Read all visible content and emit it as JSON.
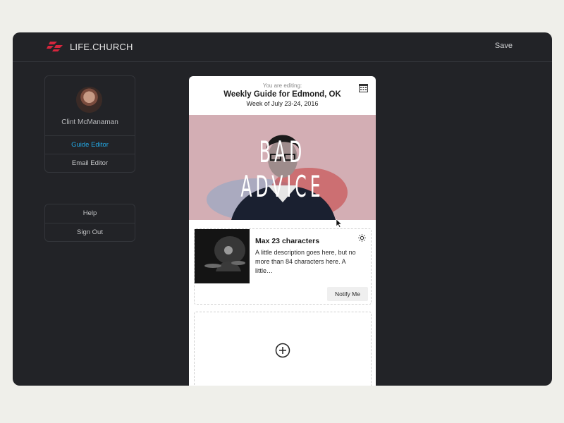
{
  "brand": {
    "name": "LIFE.CHURCH",
    "accent": "#d7263d"
  },
  "topbar": {
    "save_label": "Save"
  },
  "sidebar": {
    "user_name": "Clint McManaman",
    "items": [
      {
        "label": "Guide Editor",
        "active": true
      },
      {
        "label": "Email Editor",
        "active": false
      }
    ],
    "aux_items": [
      {
        "label": "Help"
      },
      {
        "label": "Sign Out"
      }
    ]
  },
  "editor": {
    "subtitle": "You are editing:",
    "title": "Weekly Guide for Edmond, OK",
    "week": "Week of July 23-24, 2016",
    "hero_text": "BAD ADVICE",
    "item": {
      "title": "Max 23 characters",
      "description": "A little description goes here, but no more than 84 characters here. A little…",
      "notify_label": "Notify Me"
    }
  },
  "icons": [
    "calendar-icon",
    "gear-icon",
    "add-circle-icon"
  ],
  "colors": {
    "background": "#222327",
    "active_link": "#23a7e3",
    "page": "#efefea"
  }
}
